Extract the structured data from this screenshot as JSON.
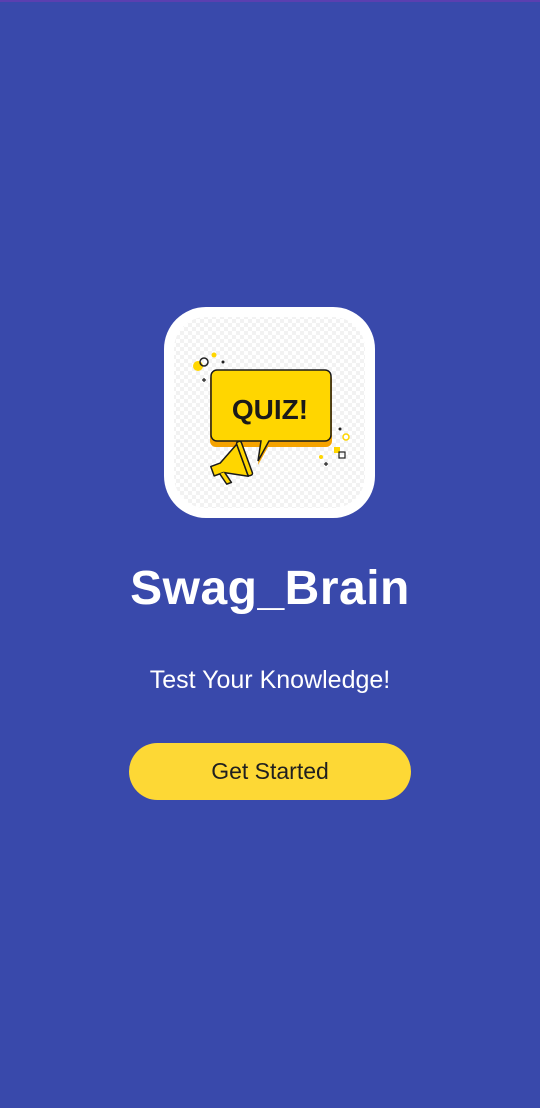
{
  "app": {
    "logo_text": "QUIZ!",
    "logo_icon": "quiz-speech-bubble-megaphone",
    "title": "Swag_Brain",
    "subtitle": "Test Your Knowledge!",
    "cta_label": "Get Started"
  },
  "colors": {
    "background": "#3949AB",
    "button": "#FDD835",
    "logo_bubble": "#FFD600"
  }
}
